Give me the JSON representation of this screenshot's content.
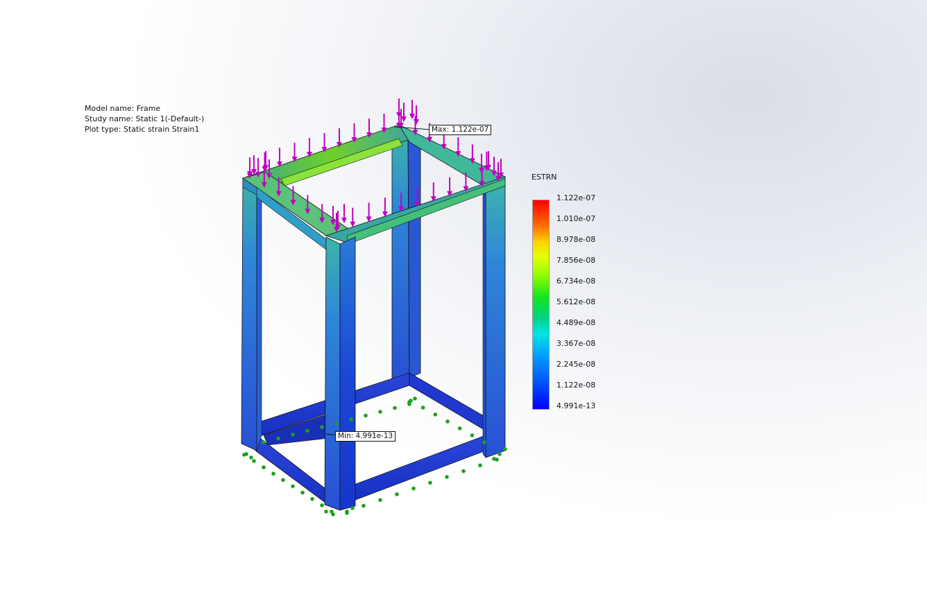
{
  "study_info": {
    "model_name": "Model name: Frame",
    "study_name": "Study name: Static 1(-Default-)",
    "plot_type": "Plot type: Static strain Strain1"
  },
  "legend": {
    "title": "ESTRN",
    "labels": [
      "1.122e-07",
      "1.010e-07",
      "8.978e-08",
      "7.856e-08",
      "6.734e-08",
      "5.612e-08",
      "4.489e-08",
      "3.367e-08",
      "2.245e-08",
      "1.122e-08",
      "4.991e-13"
    ]
  },
  "markers": {
    "max_label": "Max: 1.122e-07",
    "min_label": "Min: 4.991e-13"
  },
  "colors": {
    "load_arrow": "#c000c0",
    "fixture": "#1ea01e",
    "strain_low": "#1a3fd0",
    "strain_mid": "#2fa8c8",
    "strain_high": "#6fcf2a"
  }
}
